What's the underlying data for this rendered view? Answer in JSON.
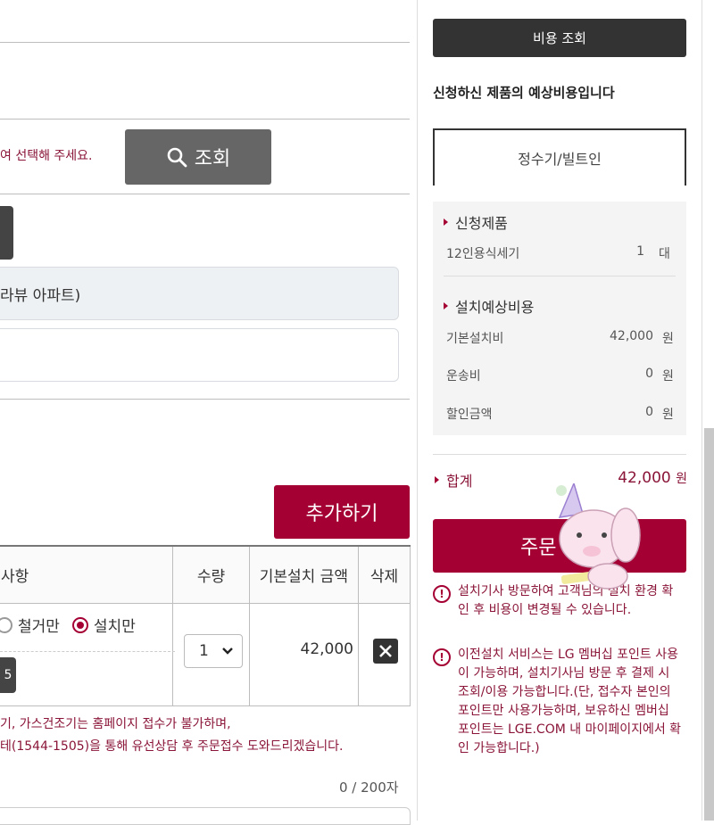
{
  "search": {
    "hint": "여 선택해 주세요.",
    "button_label": "조회"
  },
  "address": {
    "line1": "라뷰 아파트)"
  },
  "add_button": "추가하기",
  "table": {
    "headers": [
      "사항",
      "수량",
      "기본설치 금액",
      "삭제"
    ],
    "row": {
      "option_remove": "철거만",
      "option_install": "설치만",
      "selected_option": "설치만",
      "small_label": "5",
      "quantity": "1",
      "price": "42,000"
    }
  },
  "notes": {
    "line1": "기, 가스건조기는 홈페이지 접수가 불가하며,",
    "line2": "테(1544-1505)을 통해 유선상담 후 주문접수 도와드리겠습니다."
  },
  "char_counter": "0 / 200자",
  "panel": {
    "cost_button": "비용 조회",
    "heading": "신청하신 제품의 예상비용입니다",
    "tab": "정수기/빌트인",
    "product_section": "신청제품",
    "product_name": "12인용식세기",
    "product_qty": "1",
    "product_unit": "대",
    "cost_section": "설치예상비용",
    "costs": [
      {
        "label": "기본설치비",
        "value": "42,000",
        "unit": "원"
      },
      {
        "label": "운송비",
        "value": "0",
        "unit": "원"
      },
      {
        "label": "할인금액",
        "value": "0",
        "unit": "원"
      }
    ],
    "total_label": "합계",
    "total_value": "42,000",
    "total_unit": "원",
    "order_button": "주문 접수",
    "notice1": "설치기사 방문하여 고객님의 설치 환경 확인 후 비용이 변경될 수 있습니다.",
    "notice2": "이전설치 서비스는 LG 멤버십 포인트 사용이 가능하며, 설치기사님 방문 후 결제 시 조회/이용 가능합니다.(단, 접수자 본인의 포인트만 사용가능하며, 보유하신 멤버십 포인트는 LGE.COM 내 마이페이지에서 확인 가능합니다.)"
  },
  "colors": {
    "brand": "#a50034",
    "dark_button": "#333333",
    "search_button": "#666666"
  },
  "icons": [
    "search-icon",
    "chevron-down-icon",
    "close-icon",
    "warning-icon",
    "triangle-bullet-icon"
  ]
}
